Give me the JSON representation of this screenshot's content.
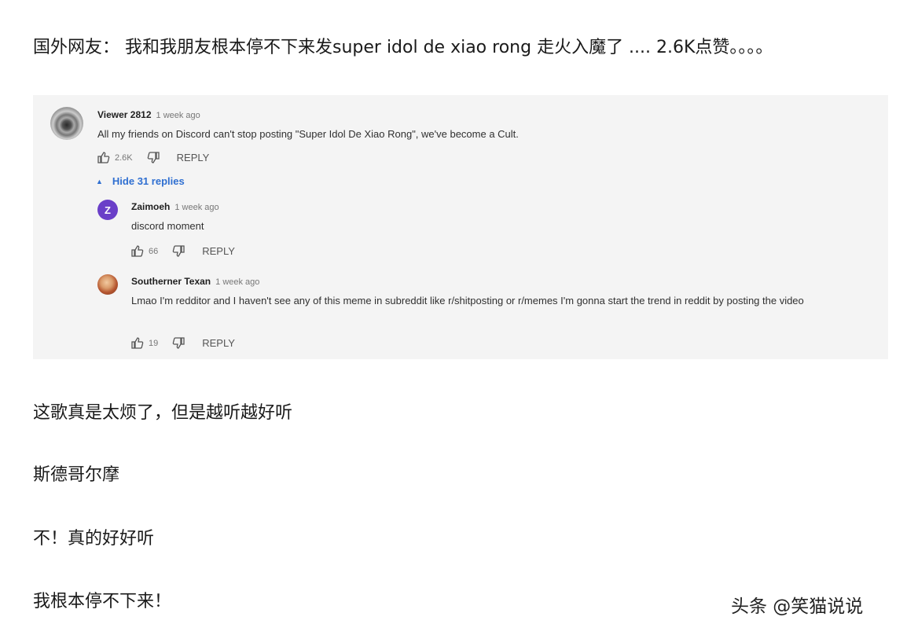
{
  "article": {
    "intro": "国外网友：  我和我朋友根本停不下来发super idol de xiao rong 走火入魔了 .... 2.6K点赞。。。。",
    "lines": [
      "这歌真是太烦了，但是越听越好听",
      "斯德哥尔摩",
      "不！真的好好听",
      "我根本停不下来！"
    ]
  },
  "comment_thread": {
    "main": {
      "author": "Viewer 2812",
      "time": "1 week ago",
      "text": "All my friends on Discord can't stop posting \"Super Idol De Xiao Rong\", we've become a Cult.",
      "likes": "2.6K",
      "reply_label": "REPLY"
    },
    "hide_replies_label": "Hide 31 replies",
    "replies": [
      {
        "avatar_letter": "Z",
        "author": "Zaimoeh",
        "time": "1 week ago",
        "text": "discord moment",
        "likes": "66",
        "reply_label": "REPLY"
      },
      {
        "author": "Southerner Texan",
        "time": "1 week ago",
        "text": "Lmao I'm redditor and I haven't see any of this meme in subreddit like r/shitposting or r/memes I'm gonna start the trend in reddit by posting the video",
        "likes": "19",
        "reply_label": "REPLY"
      }
    ]
  },
  "watermark": "头条 @笑猫说说",
  "colors": {
    "link_blue": "#2f6fd1",
    "zaimoeh_avatar": "#6a3fc8",
    "panel_bg": "#f4f4f4"
  }
}
